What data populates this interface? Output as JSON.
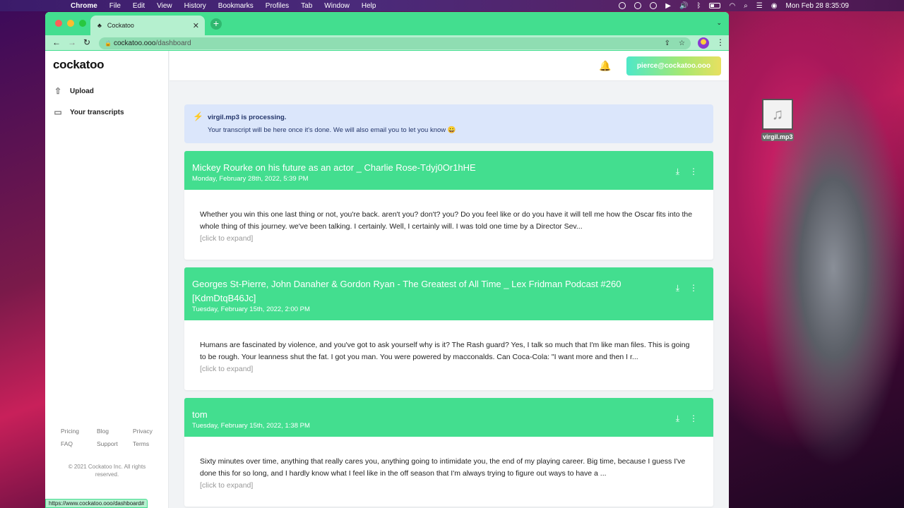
{
  "menubar": {
    "app": "Chrome",
    "items": [
      "File",
      "Edit",
      "View",
      "History",
      "Bookmarks",
      "Profiles",
      "Tab",
      "Window",
      "Help"
    ],
    "clock": "Mon Feb 28  8:35:09"
  },
  "desktop": {
    "file_name": "virgil.mp3",
    "file_icon": "music-note-icon"
  },
  "browser": {
    "tab_title": "Cockatoo",
    "url_host": "cockatoo.ooo",
    "url_path": "/dashboard",
    "status_url": "https://www.cockatoo.ooo/dashboard#"
  },
  "app": {
    "brand": "cockatoo",
    "nav": [
      {
        "label": "Upload",
        "icon": "upload-icon"
      },
      {
        "label": "Your transcripts",
        "icon": "archive-icon"
      }
    ],
    "footer": {
      "row1": [
        "Pricing",
        "Blog",
        "Privacy"
      ],
      "row2": [
        "FAQ",
        "Support",
        "Terms"
      ],
      "copyright": "© 2021 Cockatoo Inc. All rights reserved."
    },
    "user_email": "pierce@cockatoo.ooo",
    "accent": "#43de8f"
  },
  "alert": {
    "title": "virgil.mp3 is processing.",
    "message": "Your transcript will be here once it's done. We will also email you to let you know 😀"
  },
  "transcripts": [
    {
      "title": "Mickey Rourke on his future as an actor _ Charlie Rose-Tdyj0Or1hHE",
      "date": "Monday, February 28th, 2022, 5:39 PM",
      "excerpt": "Whether you win this one last thing or not, you're back. aren't you? don't? you? Do you feel like or do you have it will tell me how the Oscar fits into the whole thing of this journey. we've been talking. I certainly. Well, I certainly will. I was told one time by a Director Sev...",
      "expand": "[click to expand]"
    },
    {
      "title": "Georges St-Pierre, John Danaher & Gordon Ryan - The Greatest of All Time _ Lex Fridman Podcast #260 [KdmDtqB46Jc]",
      "date": "Tuesday, February 15th, 2022, 2:00 PM",
      "excerpt": "Humans are fascinated by violence, and you've got to ask yourself why is it? The Rash guard? Yes, I talk so much that I'm like man files. This is going to be rough. Your leanness shut the fat. I got you man. You were powered by macconalds. Can Coca-Cola: \"I want more and then I r...",
      "expand": "[click to expand]"
    },
    {
      "title": "tom",
      "date": "Tuesday, February 15th, 2022, 1:38 PM",
      "excerpt": "Sixty minutes over time, anything that really cares you, anything going to intimidate you, the end of my playing career. Big time, because I guess I've done this for so long, and I hardly know what I feel like in the off season that I'm always trying to figure out ways to have a ...",
      "expand": "[click to expand]"
    }
  ]
}
